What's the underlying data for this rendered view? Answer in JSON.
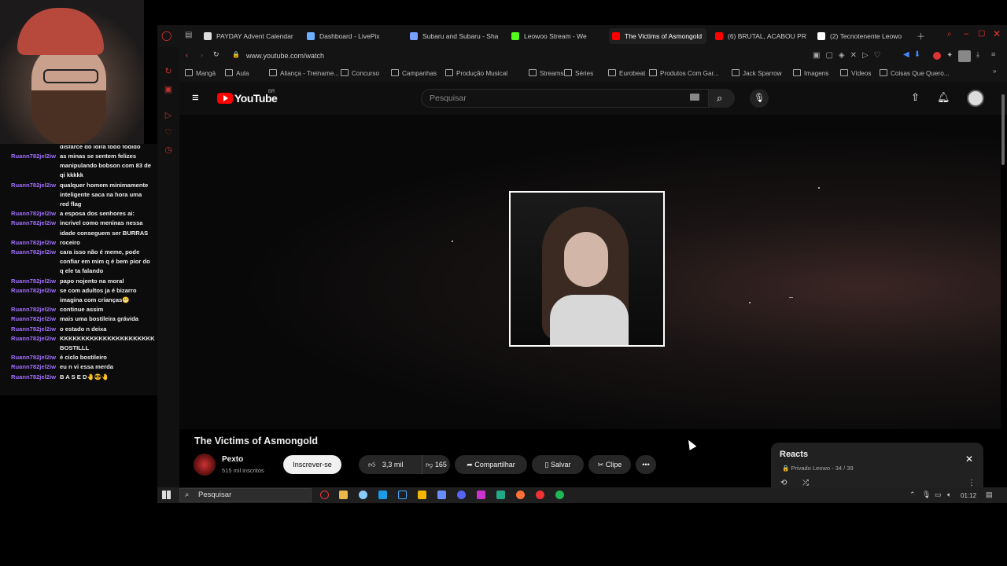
{
  "chat": {
    "partial_top": "disfarce do loira todo fodido",
    "messages": [
      {
        "user": "Ruann782jel2iw",
        "text": "as minas se sentem felizes manipulando bobson com 83 de qi kkkkk"
      },
      {
        "user": "Ruann782jel2iw",
        "text": "qualquer homem minimamente inteligente saca na hora uma red flag"
      },
      {
        "user": "Ruann782jel2iw",
        "text": "a esposa dos senhores ai:"
      },
      {
        "user": "Ruann782jel2iw",
        "text": "incrivel como meninas nessa idade conseguem ser BURRAS"
      },
      {
        "user": "Ruann782jel2iw",
        "text": "roceiro"
      },
      {
        "user": "Ruann782jel2iw",
        "text": "cara isso não é meme, pode confiar em mim q é bem pior do q ele ta falando"
      },
      {
        "user": "Ruann782jel2iw",
        "text": "papo nojento na moral"
      },
      {
        "user": "Ruann782jel2iw",
        "text": "se com adultos ja é bizarro imagina com crianças😬"
      },
      {
        "user": "Ruann782jel2iw",
        "text": "continue assim"
      },
      {
        "user": "Ruann782jel2iw",
        "text": "mais uma bostileira grávida"
      },
      {
        "user": "Ruann782jel2iw",
        "text": "o estado n deixa"
      },
      {
        "user": "Ruann782jel2iw",
        "text": "KKKKKKKKKKKKKKKKKKKKKK BOSTILLL"
      },
      {
        "user": "Ruann782jel2iw",
        "text": "é ciclo bostileiro"
      },
      {
        "user": "Ruann782jel2iw",
        "text": "eu n vi essa merda"
      },
      {
        "user": "Ruann782jel2iw",
        "text": "B A S E D🤚😎🤚"
      }
    ]
  },
  "tabs": [
    {
      "label": "PAYDAY Advent Calendar",
      "color": "#ddd",
      "active": false
    },
    {
      "label": "Dashboard - LivePix",
      "color": "#6ab0ff",
      "active": false
    },
    {
      "label": "Subaru and Subaru - Sha",
      "color": "#7aa0ff",
      "active": false
    },
    {
      "label": "Leowoo Stream - We",
      "color": "#53fc18",
      "active": false
    },
    {
      "label": "The Victims of Asmongold",
      "color": "#ff0000",
      "active": true
    },
    {
      "label": "(6) BRUTAL, ACABOU PRO",
      "color": "#ff0000",
      "active": false
    },
    {
      "label": "(2) Tecnotenente Leowo",
      "color": "#fff",
      "active": false
    }
  ],
  "url": "www.youtube.com/watch",
  "bookmarks": [
    "Mangá",
    "Aula",
    "Aliança - Treiname...",
    "Concurso",
    "Campanhas",
    "Produção Musical",
    "Streams",
    "Séries",
    "Eurobeat",
    "Produtos Com Gar...",
    "Jack Sparrow",
    "Imagens",
    "Vídeos",
    "Coisas Que Quero..."
  ],
  "youtube": {
    "logo": "YouTube",
    "region": "BR",
    "search_placeholder": "Pesquisar",
    "video_title": "The Victims of Asmongold",
    "channel": "Pexto",
    "subscribers": "515 mil inscritos",
    "subscribe_label": "Inscrever-se",
    "likes": "3,3 mil",
    "dislikes": "165",
    "share_label": "Compartilhar",
    "save_label": "Salvar",
    "clip_label": "Clipe"
  },
  "playlist": {
    "title": "Reacts",
    "subtitle": "Privado Leowo - 34 / 39"
  },
  "taskbar": {
    "search_label": "Pesquisar",
    "time": "01:12"
  }
}
